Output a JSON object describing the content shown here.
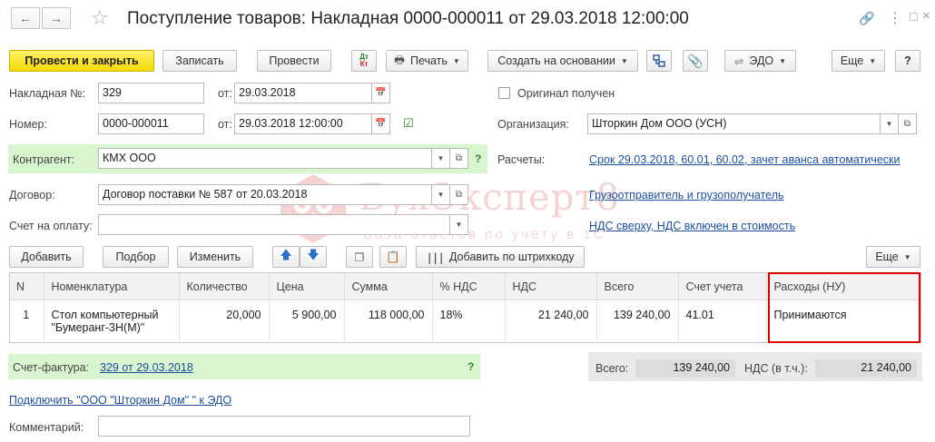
{
  "window": {
    "title": "Поступление товаров: Накладная 0000-000011 от 29.03.2018 12:00:00"
  },
  "toolbar": {
    "post_close": "Провести и закрыть",
    "save": "Записать",
    "post": "Провести",
    "dtkt_top": "Дт",
    "dtkt_bottom": "Кт",
    "print": "Печать",
    "create_based": "Создать на основании",
    "edo": "ЭДО",
    "more": "Еще",
    "help": "?"
  },
  "form": {
    "invoice_label": "Накладная №:",
    "invoice_value": "329",
    "from_label": "от:",
    "invoice_date": "29.03.2018",
    "original_label": "Оригинал получен",
    "number_label": "Номер:",
    "number_value": "0000-000011",
    "number_date": "29.03.2018 12:00:00",
    "org_label": "Организация:",
    "org_value": "Шторкин Дом ООО (УСН)",
    "counterparty_label": "Контрагент:",
    "counterparty_value": "КМХ ООО",
    "counterparty_q": "?",
    "settlements_label": "Расчеты:",
    "settlements_link": "Срок 29.03.2018, 60.01, 60.02, зачет аванса автоматически",
    "contract_label": "Договор:",
    "contract_value": "Договор поставки № 587 от 20.03.2018",
    "shipper_link": "Грузоотправитель и грузополучатель",
    "payment_label": "Счет на оплату:",
    "payment_value": "",
    "vat_link": "НДС сверху, НДС включен в стоимость"
  },
  "watermark": {
    "title": "БухЭксперт8",
    "subtitle": "База ответов по учёту в 1С"
  },
  "table_toolbar": {
    "add": "Добавить",
    "pick": "Подбор",
    "edit": "Изменить",
    "barcode": "Добавить по штрихкоду",
    "more": "Еще"
  },
  "table": {
    "headers": [
      "N",
      "Номенклатура",
      "Количество",
      "Цена",
      "Сумма",
      "% НДС",
      "НДС",
      "Всего",
      "Счет учета",
      "Расходы (НУ)"
    ],
    "rows": [
      {
        "n": "1",
        "item": "Стол компьютерный \"Бумеранг-3Н(М)\"",
        "qty": "20,000",
        "price": "5 900,00",
        "sum": "118 000,00",
        "vat_rate": "18%",
        "vat": "21 240,00",
        "total": "139 240,00",
        "account": "41.01",
        "expenses": "Принимаются"
      }
    ]
  },
  "footer": {
    "invoice_label": "Счет-фактура:",
    "invoice_link": "329 от 29.03.2018",
    "invoice_q": "?",
    "total_label": "Всего:",
    "total_value": "139 240,00",
    "vat_label": "НДС (в т.ч.):",
    "vat_value": "21 240,00",
    "edo_link": "Подключить \"ООО \"Шторкин Дом\" \" к ЭДО",
    "comment_label": "Комментарий:",
    "comment_value": ""
  },
  "colors": {
    "primary_button": "#f5d800",
    "green_band": "#d9f5cf",
    "link": "#1c4f9c",
    "highlight": "#e00000"
  }
}
